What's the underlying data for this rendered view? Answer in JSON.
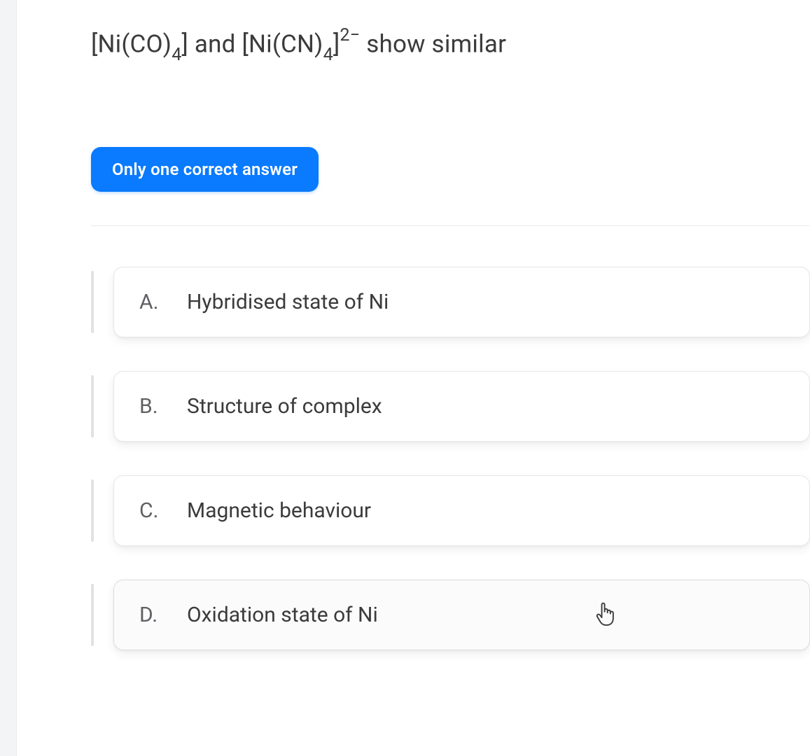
{
  "question": {
    "prefix": "[Ni(CO)",
    "sub1": "4",
    "mid1": "] and [Ni(CN)",
    "sub2": "4",
    "mid2": "]",
    "sup": "2−",
    "suffix": " show similar"
  },
  "badge": {
    "label": "Only one correct answer"
  },
  "options": [
    {
      "letter": "A.",
      "label": "Hybridised state of Ni",
      "hovered": false
    },
    {
      "letter": "B.",
      "label": "Structure of complex",
      "hovered": false
    },
    {
      "letter": "C.",
      "label": "Magnetic behaviour",
      "hovered": false
    },
    {
      "letter": "D.",
      "label": "Oxidation state of Ni",
      "hovered": true
    }
  ],
  "colors": {
    "badge_bg": "#0a7aff",
    "text_primary": "#3b3b3b",
    "text_muted": "#5f6064",
    "border": "#e6e7ea"
  }
}
